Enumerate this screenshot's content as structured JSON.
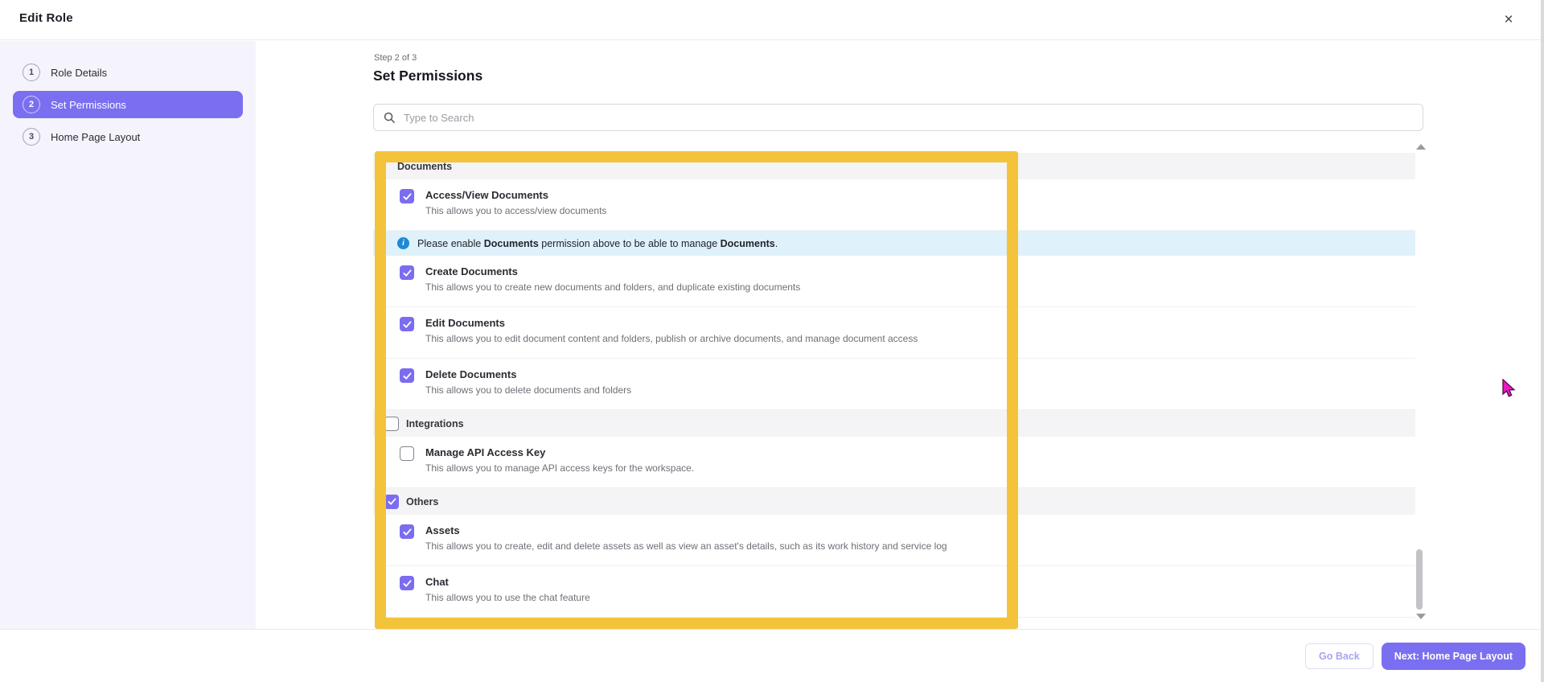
{
  "window": {
    "title": "Edit Role",
    "close_glyph": "×"
  },
  "colors": {
    "accent_purple": "#7A6FF0",
    "checkbox_purple": "#7B6CF0",
    "annotation_yellow": "#F3C43B",
    "banner_blue_bg": "#DFF1FB",
    "info_icon_blue": "#1E88D2",
    "sidebar_bg": "#F5F4FC",
    "section_row_bg": "#F4F4F6",
    "cursor_magenta": "#E818C8"
  },
  "steps": {
    "items": [
      {
        "number": "1",
        "label": "Role Details",
        "active": false
      },
      {
        "number": "2",
        "label": "Set Permissions",
        "active": true
      },
      {
        "number": "3",
        "label": "Home Page Layout",
        "active": false
      }
    ]
  },
  "content": {
    "step_indicator": "Step 2 of 3",
    "heading": "Set Permissions",
    "search": {
      "placeholder": "Type to Search"
    }
  },
  "banner": {
    "prefix": "Please enable ",
    "bold1": "Documents",
    "middle": " permission above to be able to manage ",
    "bold2": "Documents",
    "suffix": "."
  },
  "permissions": {
    "rows": [
      {
        "type": "section",
        "title": "Documents",
        "checkbox": "none"
      },
      {
        "type": "item",
        "checked": true,
        "title": "Access/View Documents",
        "description": "This allows you to access/view documents"
      },
      {
        "type": "banner"
      },
      {
        "type": "item",
        "checked": true,
        "title": "Create Documents",
        "description": "This allows you to create new documents and folders, and duplicate existing documents"
      },
      {
        "type": "item",
        "checked": true,
        "title": "Edit Documents",
        "description": "This allows you to edit document content and folders, publish or archive documents, and manage document access"
      },
      {
        "type": "item",
        "checked": true,
        "title": "Delete Documents",
        "description": "This allows you to delete documents and folders"
      },
      {
        "type": "section",
        "title": "Integrations",
        "checked": false
      },
      {
        "type": "item",
        "checked": false,
        "title": "Manage API Access Key",
        "description": "This allows you to manage API access keys for the workspace."
      },
      {
        "type": "section",
        "title": "Others",
        "checked": true
      },
      {
        "type": "item",
        "checked": true,
        "title": "Assets",
        "description": "This allows you to create, edit and delete assets as well as view an asset's details, such as its work history and service log"
      },
      {
        "type": "item",
        "checked": true,
        "title": "Chat",
        "description": "This allows you to use the chat feature"
      }
    ]
  },
  "footer": {
    "go_back_label": "Go Back",
    "next_label": "Next: Home Page Layout"
  }
}
